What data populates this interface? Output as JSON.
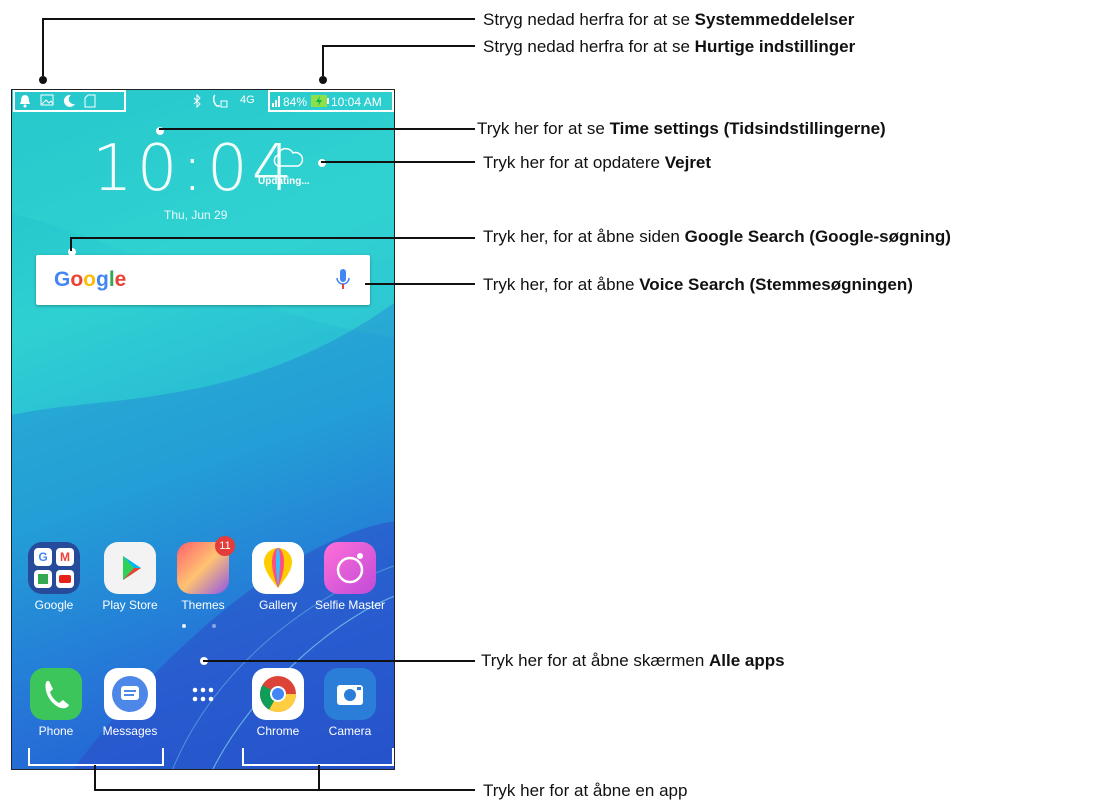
{
  "status_bar": {
    "battery": "84%",
    "time": "10:04 AM",
    "network": "4G",
    "left_icons": [
      "notification-icon",
      "image-icon",
      "moon-icon",
      "sim-icon"
    ],
    "right_icons": [
      "bluetooth-icon",
      "call-icon",
      "signal-icon",
      "battery-icon"
    ]
  },
  "clock": {
    "time": "10:04",
    "date": "Thu, Jun 29"
  },
  "weather": {
    "status": "Updating..."
  },
  "search": {
    "logo": "Google"
  },
  "apps_row1": [
    {
      "label": "Google"
    },
    {
      "label": "Play Store"
    },
    {
      "label": "Themes",
      "badge": "11"
    },
    {
      "label": "Gallery"
    },
    {
      "label": "Selfie Master"
    }
  ],
  "dock": [
    {
      "label": "Phone"
    },
    {
      "label": "Messages"
    },
    {
      "label": "All apps"
    },
    {
      "label": "Chrome"
    },
    {
      "label": "Camera"
    }
  ],
  "annotations": {
    "sys_notif_prefix": "Stryg nedad herfra for at se ",
    "sys_notif_bold": "Systemmeddelelser",
    "quick_prefix": "Stryg nedad herfra for at se ",
    "quick_bold": "Hurtige indstillinger",
    "time_prefix": "Tryk her for at se ",
    "time_bold": "Time settings (Tidsindstillingerne)",
    "weather_prefix": "Tryk her for at opdatere ",
    "weather_bold": "Vejret",
    "gsearch_prefix": "Tryk her, for at åbne siden ",
    "gsearch_bold": "Google Search (Google-søgning)",
    "voice_prefix": "Tryk her, for at åbne ",
    "voice_bold": "Voice Search (Stemmesøgningen)",
    "allapps_prefix": "Tryk her for at åbne skærmen  ",
    "allapps_bold": "Alle apps",
    "openapp": "Tryk her for at åbne en app"
  }
}
